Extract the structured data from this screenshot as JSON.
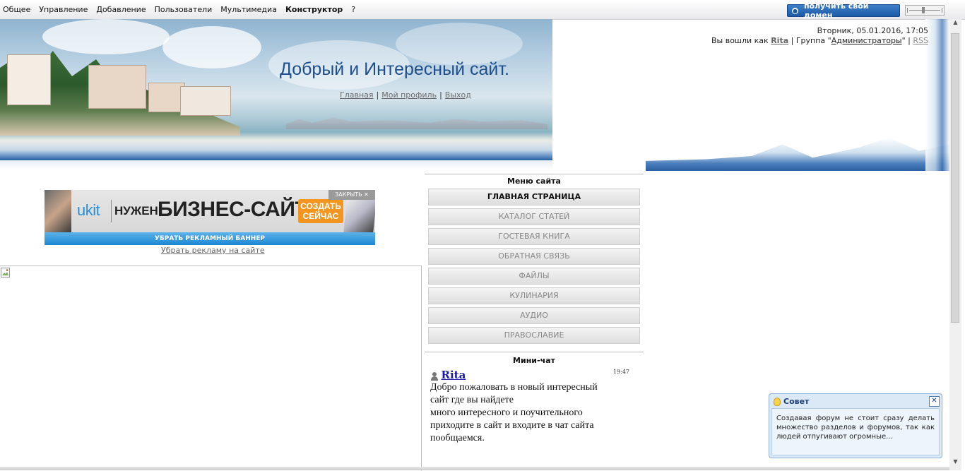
{
  "topbar": {
    "menu": [
      "Общее",
      "Управление",
      "Добавление",
      "Пользователи",
      "Мультимедиа",
      "Конструктор",
      "?"
    ],
    "active_item": "Конструктор",
    "domain_button": "получить свой домен"
  },
  "header": {
    "title": "Добрый и Интересный сайт.",
    "nav": [
      "Главная",
      "Мой профиль",
      "Выход"
    ],
    "date": "Вторник, 05.01.2016, 17:05",
    "logged_in_prefix": "Вы вошли как",
    "username": "Rita",
    "group_prefix": "Группа \"",
    "group": "Администраторы",
    "group_suffix": "\"",
    "rss": "RSS"
  },
  "ad": {
    "brand": "ukit",
    "need": "НУЖЕН",
    "headline": "БИЗНЕС-САЙТ?",
    "cta_line1": "СОЗДАТЬ",
    "cta_line2": "СЕЙЧАС",
    "close": "ЗАКРЫТЬ ✕",
    "remove_banner": "УБРАТЬ РЕКЛАМНЫЙ БАННЕР",
    "remove_ads_link": "Убрать рекламу на сайте"
  },
  "site_menu": {
    "title": "Меню сайта",
    "items": [
      {
        "label": "ГЛАВНАЯ СТРАНИЦА"
      },
      {
        "label": "КАТАЛОГ СТАТЕЙ"
      },
      {
        "label": "ГОСТЕВАЯ КНИГА"
      },
      {
        "label": "ОБРАТНАЯ СВЯЗЬ"
      },
      {
        "label": "ФАЙЛЫ"
      },
      {
        "label": "КУЛИНАРИЯ"
      },
      {
        "label": "АУДИО"
      },
      {
        "label": "ПРАВОСЛАВИЕ"
      }
    ]
  },
  "mini_chat": {
    "title": "Мини-чат",
    "author": "Rita",
    "time": "19:47",
    "lines": [
      "Добро пожаловать в новый интересный",
      "сайт где вы найдете",
      "много интересного и поучительного",
      "приходите в сайт и входите в чат сайта",
      "пообщаемся."
    ]
  },
  "tip": {
    "title": "Совет",
    "text": "Создавая форум не стоит сразу делать множество разделов и форумов, так как людей отпугивают огромные..."
  }
}
